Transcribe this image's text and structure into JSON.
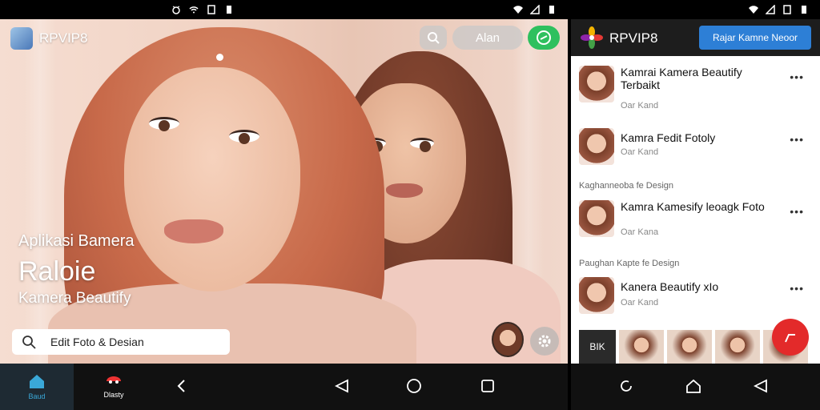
{
  "status_left": {
    "icons": [
      "alarm-icon",
      "wifi-icon",
      "sim-icon",
      "battery-icon",
      "wifi-icon",
      "signal-icon",
      "battery-icon"
    ]
  },
  "left": {
    "app_name": "RPVIP8",
    "pill_label": "Alan",
    "overlay": {
      "line1": "Aplikasi Bamera",
      "line2": "Raloie",
      "line3": "Kamera Beautify"
    },
    "search": {
      "text": "Edit Foto & Desian"
    },
    "nav": {
      "home_label": "Baud",
      "tab2_label": "Dlasty"
    }
  },
  "right": {
    "app_name": "RPVIP8",
    "cta_label": "Rajar Kamne Neoor",
    "items": [
      {
        "title": "Kamrai Kamera Beautify Terbaikt",
        "sub": "Oar Kand"
      },
      {
        "title": "Kamra Fedit Fotoly",
        "sub": "Oar Kand"
      },
      {
        "title": "Kamra Kamesify leoagk Foto",
        "sub": "Oar Kana"
      },
      {
        "title": "Kanera Beautify xIo",
        "sub": "Oar Kand"
      }
    ],
    "sections": [
      "Kaghanneoba fe Design",
      "Paughan Kapte fe Design"
    ],
    "strip_label": "BIK"
  }
}
